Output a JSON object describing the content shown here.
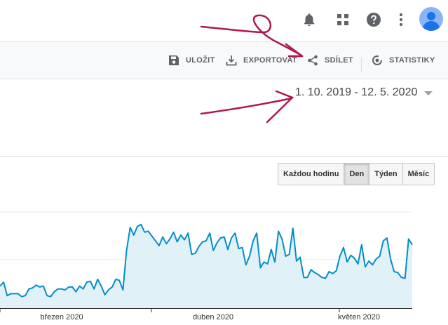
{
  "header": {
    "icons": [
      "bell-icon",
      "apps-grid-icon",
      "help-icon",
      "more-vert-icon",
      "account-avatar-icon"
    ]
  },
  "toolbar": {
    "save_label": "ULOŽIT",
    "export_label": "EXPORTOVAT",
    "share_label": "SDÍLET",
    "insights_label": "STATISTIKY"
  },
  "date_range": {
    "value": "1. 10. 2019 - 12. 5. 2020"
  },
  "granularity": {
    "options": [
      "Každou hodinu",
      "Den",
      "Týden",
      "Měsíc"
    ],
    "selected": "Den"
  },
  "annotation_color": "#b0184a",
  "chart_data": {
    "type": "area",
    "line_color": "#058dc7",
    "fill_color": "#e1f1f8",
    "x_tick_labels": [
      "březen 2020",
      "duben 2020",
      "květen 2020"
    ],
    "values": [
      23,
      27,
      13,
      15,
      15,
      15,
      12,
      13,
      20,
      21,
      24,
      22,
      23,
      13,
      12,
      17,
      20,
      20,
      19,
      22,
      22,
      17,
      23,
      20,
      27,
      28,
      20,
      30,
      23,
      14,
      19,
      22,
      30,
      29,
      19,
      60,
      84,
      76,
      85,
      87,
      79,
      80,
      75,
      70,
      65,
      74,
      67,
      72,
      79,
      69,
      76,
      71,
      78,
      56,
      57,
      64,
      69,
      70,
      78,
      60,
      68,
      73,
      74,
      61,
      73,
      78,
      62,
      63,
      45,
      54,
      70,
      78,
      42,
      48,
      46,
      61,
      48,
      80,
      72,
      54,
      56,
      83,
      49,
      53,
      32,
      32,
      40,
      37,
      35,
      32,
      31,
      38,
      36,
      39,
      54,
      63,
      48,
      55,
      52,
      46,
      66,
      43,
      49,
      45,
      51,
      54,
      70,
      73,
      51,
      38,
      37,
      32,
      31,
      72,
      66
    ]
  }
}
